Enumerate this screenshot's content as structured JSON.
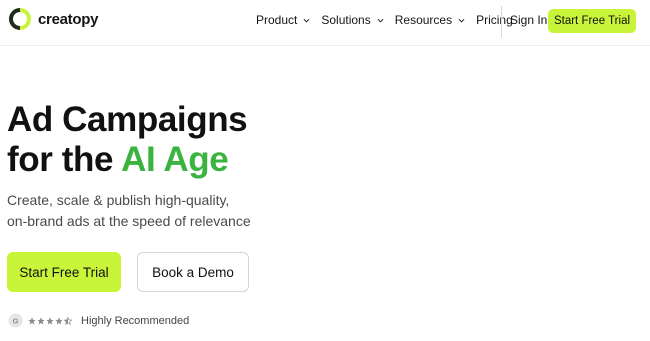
{
  "header": {
    "brand": "creatopy",
    "nav": [
      {
        "label": "Product",
        "dropdown": true
      },
      {
        "label": "Solutions",
        "dropdown": true
      },
      {
        "label": "Resources",
        "dropdown": true
      },
      {
        "label": "Pricing",
        "dropdown": false
      }
    ],
    "sign_in": "Sign In",
    "cta": "Start Free Trial"
  },
  "hero": {
    "title_line1": "Ad Campaigns",
    "title_line2_prefix": "for the ",
    "title_line2_accent": "AI Age",
    "subtitle_line1": "Create, scale & publish high-quality,",
    "subtitle_line2": "on-brand ads at the speed of relevance",
    "primary_button": "Start Free Trial",
    "secondary_button": "Book a Demo",
    "rating": {
      "stars": 4.5,
      "label": "Highly Recommended",
      "icon": "g2-icon"
    }
  },
  "colors": {
    "accent_green": "#3bb33f",
    "cta_lime": "#c8f53a",
    "text": "#111111",
    "muted": "#4a4a4a"
  }
}
